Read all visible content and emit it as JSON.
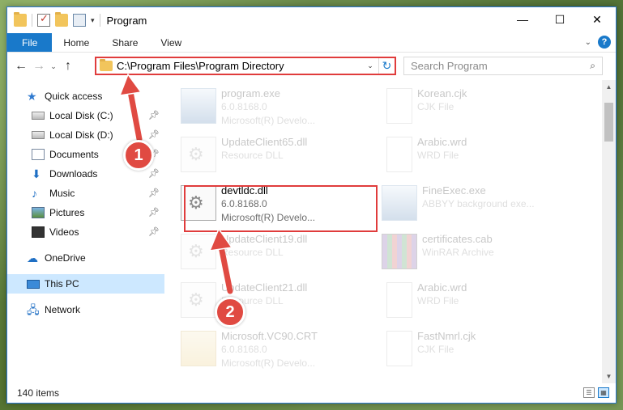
{
  "window": {
    "title": "Program",
    "controls": {
      "minimize": "—",
      "maximize": "☐",
      "close": "✕"
    }
  },
  "ribbon": {
    "tabs": [
      "File",
      "Home",
      "Share",
      "View"
    ],
    "help": "?"
  },
  "nav": {
    "back": "←",
    "forward": "→",
    "recent": "⌄",
    "up": "↑",
    "address": "C:\\Program Files\\Program Directory",
    "refresh": "↻",
    "search_placeholder": "Search Program"
  },
  "sidebar": {
    "items": [
      {
        "label": "Quick access",
        "icon": "star-icon"
      },
      {
        "label": "Local Disk (C:)",
        "icon": "drive-icon",
        "pinned": true
      },
      {
        "label": "Local Disk (D:)",
        "icon": "drive-icon",
        "pinned": true
      },
      {
        "label": "Documents",
        "icon": "documents-icon",
        "pinned": true
      },
      {
        "label": "Downloads",
        "icon": "downloads-icon",
        "pinned": true
      },
      {
        "label": "Music",
        "icon": "music-icon",
        "pinned": true
      },
      {
        "label": "Pictures",
        "icon": "pictures-icon",
        "pinned": true
      },
      {
        "label": "Videos",
        "icon": "videos-icon",
        "pinned": true
      },
      {
        "label": "OneDrive",
        "icon": "onedrive-icon"
      },
      {
        "label": "This PC",
        "icon": "computer-icon",
        "selected": true
      },
      {
        "label": "Network",
        "icon": "network-icon"
      }
    ]
  },
  "files": [
    {
      "name": "program.exe",
      "line2": "6.0.8168.0",
      "line3": "Microsoft(R) Develo...",
      "icon": "exe-icon",
      "faded": true
    },
    {
      "name": "Korean.cjk",
      "line2": "CJK File",
      "line3": "",
      "icon": "file-icon",
      "faded": true
    },
    {
      "name": "UpdateClient65.dll",
      "line2": "Resource DLL",
      "line3": "",
      "icon": "dll-icon",
      "faded": true
    },
    {
      "name": "Arabic.wrd",
      "line2": "WRD File",
      "line3": "",
      "icon": "file-icon",
      "faded": true
    },
    {
      "name": "devtldc.dll",
      "line2": "6.0.8168.0",
      "line3": "Microsoft(R) Develo...",
      "icon": "dll-icon",
      "faded": false
    },
    {
      "name": "FineExec.exe",
      "line2": "ABBYY background exe...",
      "line3": "",
      "icon": "exe-icon",
      "faded": true
    },
    {
      "name": "UpdateClient19.dll",
      "line2": "Resource DLL",
      "line3": "",
      "icon": "dll-icon",
      "faded": true
    },
    {
      "name": "certificates.cab",
      "line2": "WinRAR Archive",
      "line3": "",
      "icon": "archive-icon",
      "faded": true
    },
    {
      "name": "UpdateClient21.dll",
      "line2": "Resource DLL",
      "line3": "",
      "icon": "dll-icon",
      "faded": true
    },
    {
      "name": "Arabic.wrd",
      "line2": "WRD File",
      "line3": "",
      "icon": "file-icon",
      "faded": true
    },
    {
      "name": "Microsoft.VC90.CRT",
      "line2": "6.0.8168.0",
      "line3": "Microsoft(R) Develo...",
      "icon": "manifest-icon",
      "faded": true
    },
    {
      "name": "FastNmrl.cjk",
      "line2": "CJK File",
      "line3": "",
      "icon": "file-icon",
      "faded": true
    }
  ],
  "status": {
    "item_count": "140 items"
  },
  "annotations": {
    "step1": "1",
    "step2": "2"
  },
  "colors": {
    "accent": "#1979ca",
    "highlight": "#e03c3c",
    "selected": "#cde8ff"
  }
}
